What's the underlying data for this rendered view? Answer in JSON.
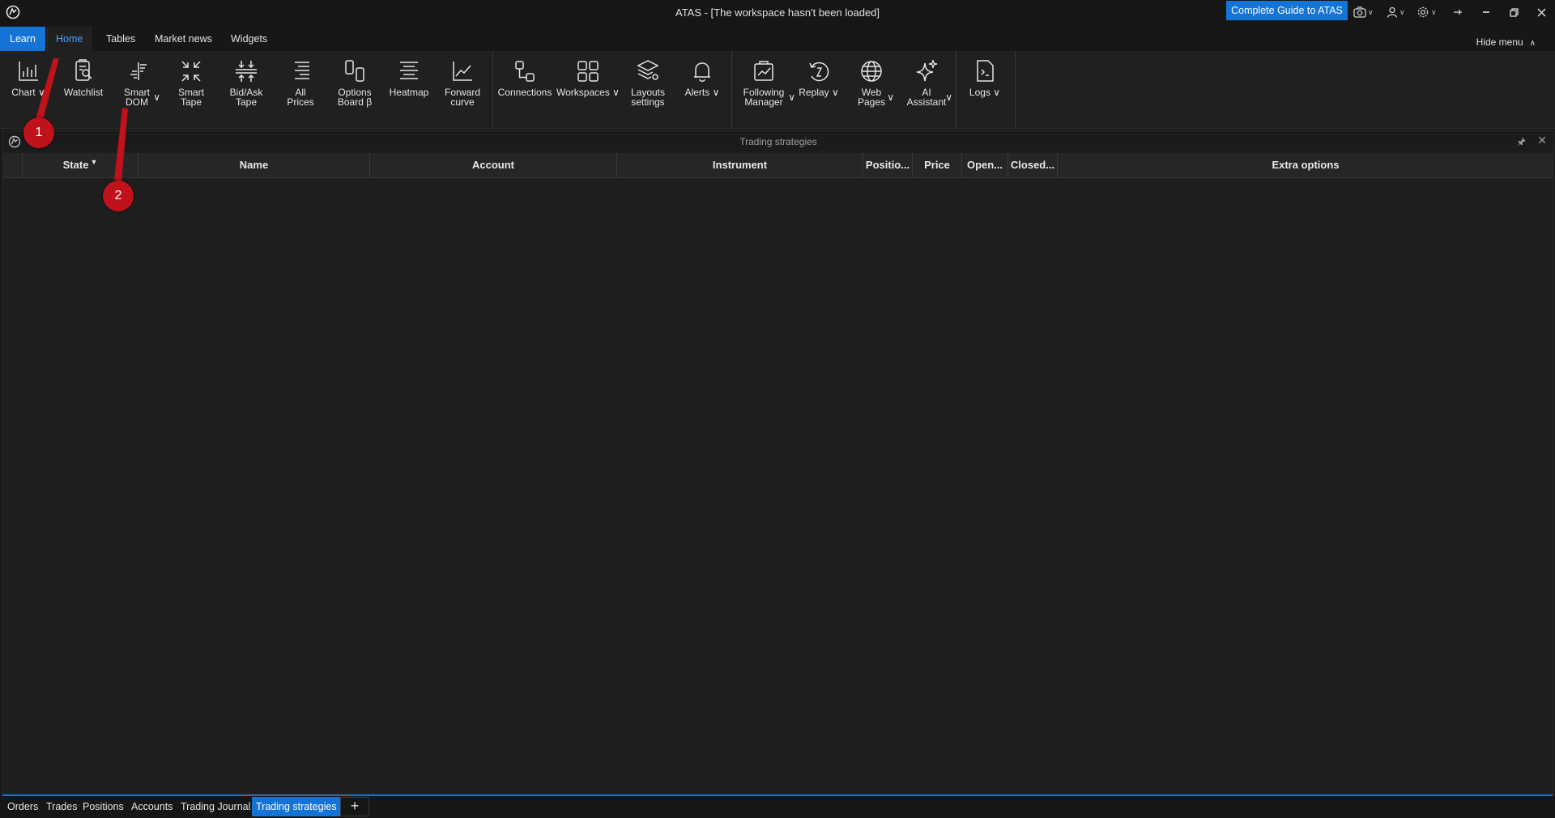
{
  "titlebar": {
    "title": "ATAS - [The workspace hasn't been loaded]",
    "guide_button": "Complete Guide to ATAS"
  },
  "menu": {
    "tabs": [
      "Learn",
      "Home",
      "Tables",
      "Market news",
      "Widgets"
    ],
    "active": "Home",
    "hide_menu": "Hide menu"
  },
  "ribbon": {
    "items": [
      {
        "label": "Chart",
        "icon": "chart-icon",
        "dropdown": true
      },
      {
        "label": "Watchlist",
        "icon": "watchlist-icon",
        "dropdown": false
      },
      {
        "label": "Smart DOM",
        "icon": "smart-dom-icon",
        "dropdown": true
      },
      {
        "label": "Smart Tape",
        "icon": "smart-tape-icon",
        "dropdown": false
      },
      {
        "label": "Bid/Ask Tape",
        "icon": "bid-ask-tape-icon",
        "dropdown": false
      },
      {
        "label": "All Prices",
        "icon": "all-prices-icon",
        "dropdown": false
      },
      {
        "label": "Options Board β",
        "icon": "options-board-icon",
        "dropdown": false
      },
      {
        "label": "Heatmap",
        "icon": "heatmap-icon",
        "dropdown": false
      },
      {
        "label": "Forward curve",
        "icon": "forward-curve-icon",
        "dropdown": false
      },
      {
        "label": "Connections",
        "icon": "connections-icon",
        "dropdown": false
      },
      {
        "label": "Workspaces",
        "icon": "workspaces-icon",
        "dropdown": true
      },
      {
        "label": "Layouts settings",
        "icon": "layouts-settings-icon",
        "dropdown": false
      },
      {
        "label": "Alerts",
        "icon": "bell-icon",
        "dropdown": true
      },
      {
        "label": "Following Manager",
        "icon": "following-manager-icon",
        "dropdown": true
      },
      {
        "label": "Replay",
        "icon": "replay-icon",
        "dropdown": true
      },
      {
        "label": "Web Pages",
        "icon": "globe-icon",
        "dropdown": true
      },
      {
        "label": "AI Assistant",
        "icon": "sparkle-icon",
        "dropdown": true
      },
      {
        "label": "Logs",
        "icon": "logs-icon",
        "dropdown": true
      }
    ]
  },
  "panel": {
    "title": "Trading strategies",
    "columns": [
      "State",
      "Name",
      "Account",
      "Instrument",
      "Positio...",
      "Price",
      "Open...",
      "Closed...",
      "Extra options"
    ],
    "rows": []
  },
  "bottom_tabs": {
    "items": [
      "Orders",
      "Trades",
      "Positions",
      "Accounts",
      "Trading Journal",
      "Trading strategies"
    ],
    "active": "Trading strategies"
  },
  "callouts": [
    "1",
    "2"
  ],
  "colors": {
    "accent": "#1473d6",
    "callout": "#c0121a",
    "background": "#1a1a1a"
  }
}
